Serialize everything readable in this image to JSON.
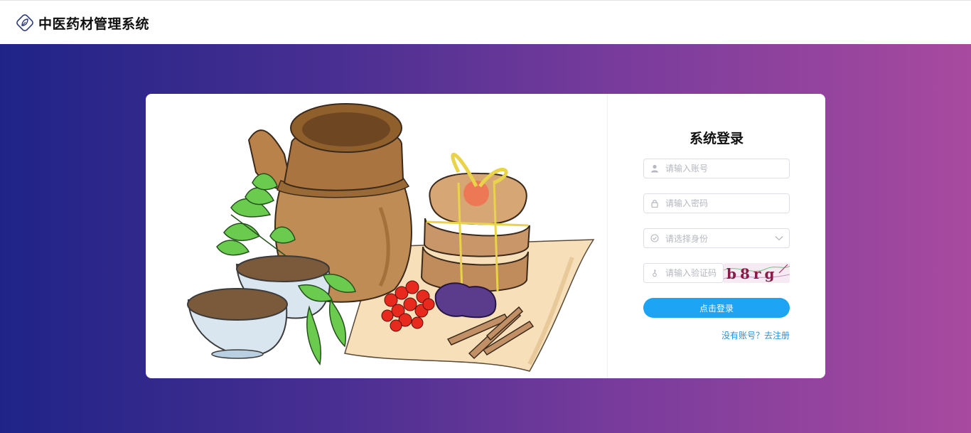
{
  "header": {
    "app_title": "中医药材管理系统",
    "logo_icon": "leaf-diamond-icon"
  },
  "login": {
    "title": "系统登录",
    "account": {
      "placeholder": "请输入账号",
      "icon": "user-icon"
    },
    "password": {
      "placeholder": "请输入密码",
      "icon": "lock-icon"
    },
    "role": {
      "placeholder": "请选择身份",
      "icon": "check-circle-icon",
      "selected": ""
    },
    "captcha": {
      "placeholder": "请输入验证码",
      "icon": "key-icon",
      "code": "b8rg"
    },
    "submit_label": "点击登录",
    "register_link": "没有账号？去注册"
  },
  "colors": {
    "gradient_start": "#1f2387",
    "gradient_end": "#a84a9f",
    "button": "#1ea4f5",
    "link": "#2b8fd9"
  }
}
